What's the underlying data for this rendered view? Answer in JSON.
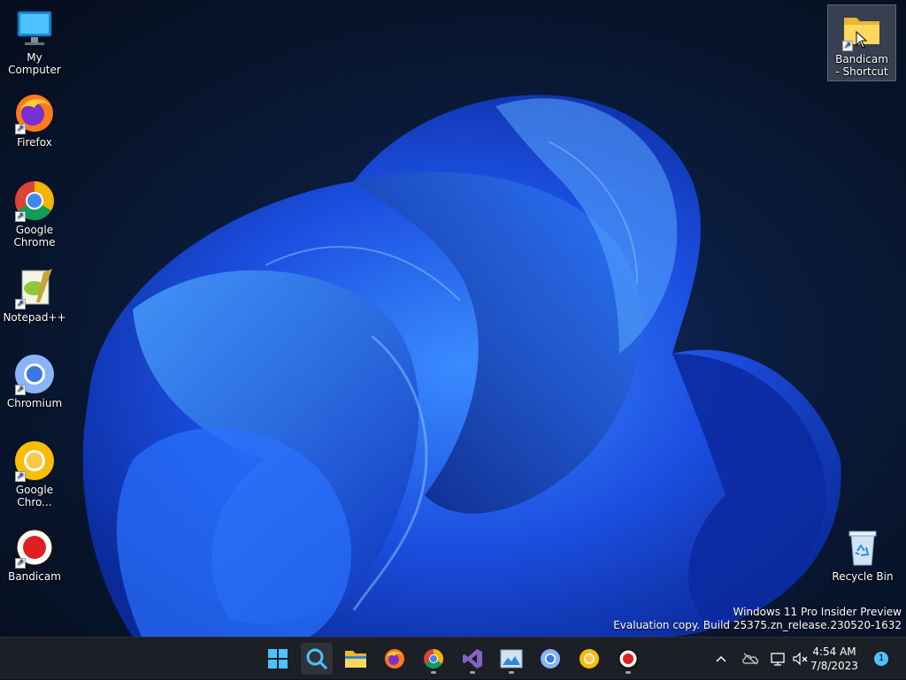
{
  "desktop_icons": [
    {
      "label": "My Computer"
    },
    {
      "label": "Firefox"
    },
    {
      "label": "Google Chrome"
    },
    {
      "label": "Notepad++"
    },
    {
      "label": "Chromium"
    },
    {
      "label": "Google Chro..."
    },
    {
      "label": "Bandicam"
    },
    {
      "label": "Bandicam - Shortcut"
    },
    {
      "label": "Recycle Bin"
    }
  ],
  "watermark": {
    "line1": "Windows 11 Pro Insider Preview",
    "line2": "Evaluation copy. Build 25375.zn_release.230520-1632"
  },
  "taskbar": {
    "apps": [
      "start-icon",
      "search-icon",
      "file-explorer-icon",
      "firefox-icon",
      "chrome-icon",
      "visual-studio-icon",
      "photos-icon",
      "chromium-icon",
      "chrome-canary-icon",
      "bandicam-icon"
    ],
    "clock": {
      "time": "4:54 AM",
      "date": "7/8/2023"
    },
    "notification_count": "1"
  },
  "colors": {
    "taskbar_bg": "#1c1f26",
    "accent": "#4cc2ff",
    "bloom": "#1f5fff"
  }
}
